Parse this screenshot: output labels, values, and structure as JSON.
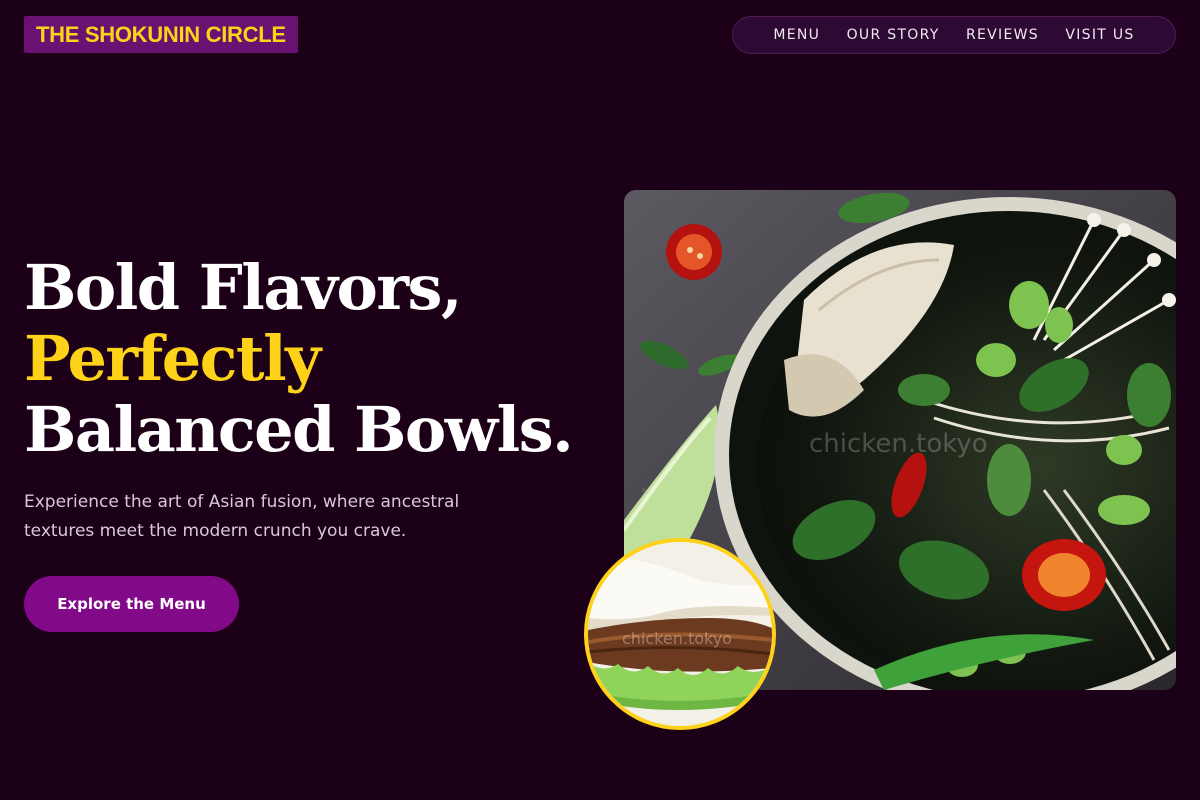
{
  "brand": {
    "name": "THE SHOKUNIN CIRCLE",
    "colors": {
      "background": "#1b0017",
      "accent": "#ffd21a",
      "primary": "#820a88"
    }
  },
  "nav": {
    "items": [
      {
        "label": "MENU"
      },
      {
        "label": "OUR STORY"
      },
      {
        "label": "REVIEWS"
      },
      {
        "label": "VISIT US"
      }
    ]
  },
  "hero": {
    "headline_line1": "Bold Flavors,",
    "headline_line2": "Perfectly",
    "headline_line3": "Balanced Bowls.",
    "subtitle": "Experience the art of Asian fusion, where ancestral textures meet the modern crunch you crave.",
    "cta_label": "Explore the Menu"
  },
  "images": {
    "main_watermark": "chicken.tokyo",
    "inset_watermark": "chicken.tokyo"
  }
}
